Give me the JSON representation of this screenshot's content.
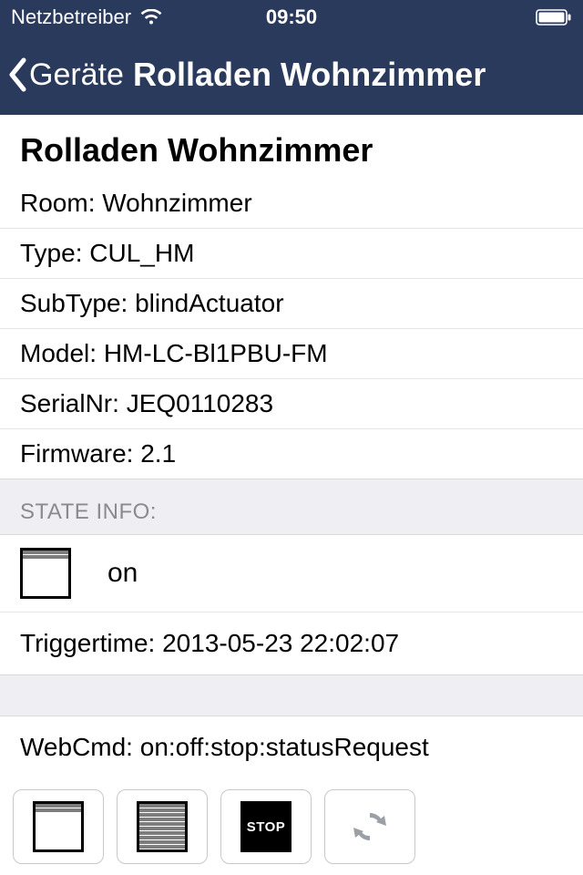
{
  "statusbar": {
    "carrier": "Netzbetreiber",
    "time": "09:50"
  },
  "nav": {
    "back_label": "Geräte",
    "title": "Rolladen Wohnzimmer"
  },
  "device": {
    "title": "Rolladen Wohnzimmer",
    "attrs": {
      "room_label": "Room: Wohnzimmer",
      "type_label": "Type: CUL_HM",
      "subtype_label": "SubType: blindActuator",
      "model_label": "Model: HM-LC-Bl1PBU-FM",
      "serial_label": "SerialNr: JEQ0110283",
      "firmware_label": "Firmware: 2.1"
    }
  },
  "state_section": {
    "header": "STATE INFO:",
    "state_value": "on",
    "trigger_label": "Triggertime: 2013-05-23 22:02:07"
  },
  "webcmd": {
    "label": "WebCmd: on:off:stop:statusRequest",
    "stop_text": "STOP"
  }
}
